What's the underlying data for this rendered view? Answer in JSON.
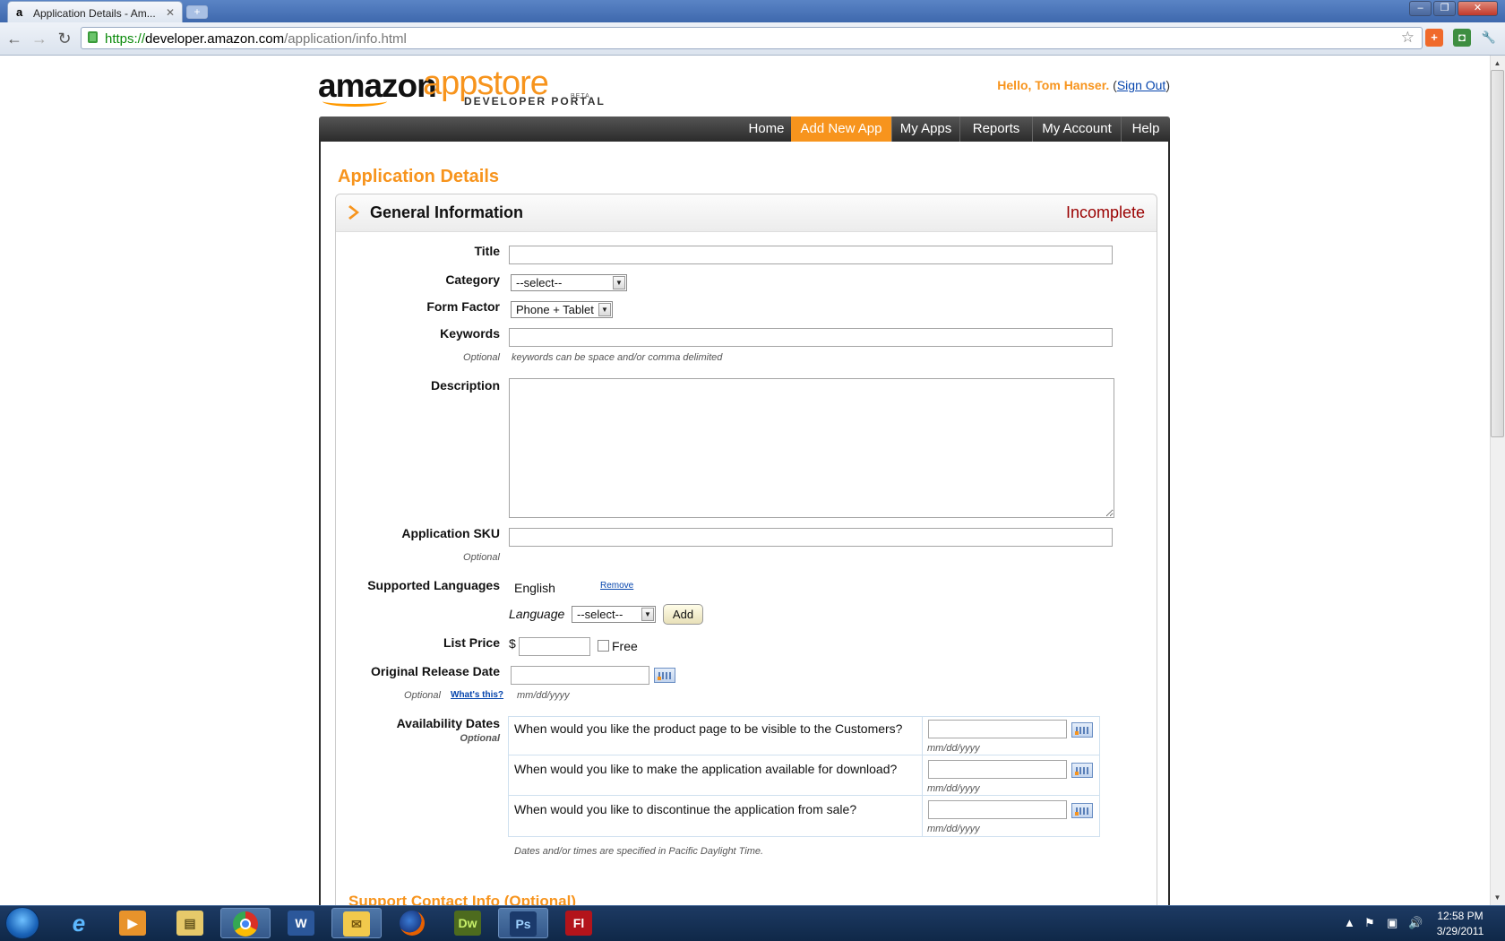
{
  "browser": {
    "tab_title": "Application Details - Am...",
    "tab_favicon": "a",
    "url_https": "https://",
    "url_host": "developer.amazon.com",
    "url_path": "/application/info.html"
  },
  "header": {
    "logo_amazon": "amazon",
    "logo_appstore": "appstore",
    "logo_subtitle": "DEVELOPER PORTAL",
    "logo_beta": "BETA",
    "greeting": "Hello, Tom Hanser.",
    "sign_out": "Sign Out"
  },
  "nav": {
    "items": [
      "Home",
      "Add New App",
      "My Apps",
      "Reports",
      "My Account",
      "Help"
    ],
    "active": "Add New App",
    "accent_color": "#f7941d"
  },
  "page": {
    "title": "Application Details",
    "section_title": "General Information",
    "section_status": "Incomplete",
    "status_color": "#9a0000"
  },
  "form": {
    "title_label": "Title",
    "title_value": "",
    "category_label": "Category",
    "category_value": "--select--",
    "form_factor_label": "Form Factor",
    "form_factor_value": "Phone + Tablet",
    "keywords_label": "Keywords",
    "keywords_value": "",
    "keywords_optional": "Optional",
    "keywords_hint": "keywords can be space and/or comma delimited",
    "description_label": "Description",
    "description_value": "",
    "sku_label": "Application SKU",
    "sku_value": "",
    "sku_optional": "Optional",
    "languages_label": "Supported Languages",
    "language_current": "English",
    "language_remove": "Remove",
    "language_select_label": "Language",
    "language_select_value": "--select--",
    "language_add": "Add",
    "price_label": "List Price",
    "price_currency": "$",
    "price_value": "",
    "price_free_label": "Free",
    "price_free_checked": false,
    "release_label": "Original Release Date",
    "release_value": "",
    "release_optional": "Optional",
    "release_whats_this": "What's this?",
    "release_format": "mm/dd/yyyy",
    "availability_label": "Availability Dates",
    "availability_optional": "Optional",
    "availability_rows": [
      {
        "question": "When would you like the product page to be visible to the Customers?",
        "value": "",
        "format": "mm/dd/yyyy"
      },
      {
        "question": "When would you like to make the application available for download?",
        "value": "",
        "format": "mm/dd/yyyy"
      },
      {
        "question": "When would you like to discontinue the application from sale?",
        "value": "",
        "format": "mm/dd/yyyy"
      }
    ],
    "timezone_note": "Dates and/or times are specified in Pacific Daylight Time.",
    "next_section": "Support Contact Info (Optional)"
  },
  "taskbar": {
    "apps": [
      "start-orb",
      "internet-explorer",
      "media-player",
      "file-explorer",
      "chrome",
      "word",
      "outlook",
      "firefox",
      "dreamweaver",
      "photoshop",
      "flash"
    ],
    "dw_label": "Dw",
    "ps_label": "Ps",
    "fl_label": "Fl",
    "word_label": "W",
    "time": "12:58 PM",
    "date": "3/29/2011"
  }
}
